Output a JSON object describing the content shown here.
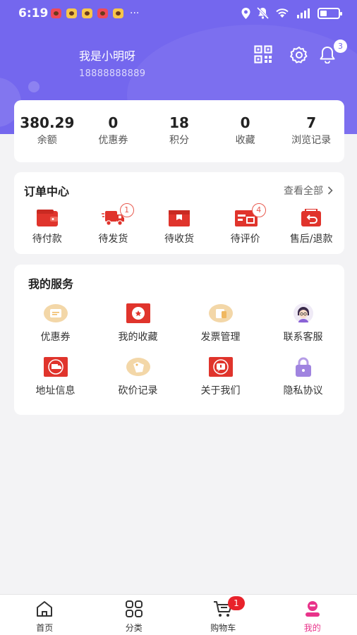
{
  "status_bar": {
    "time": "6:19",
    "more": "···"
  },
  "profile": {
    "name": "我是小明呀",
    "phone": "18888888889",
    "notification_count": "3"
  },
  "stats": [
    {
      "value": "380.29",
      "label": "余额"
    },
    {
      "value": "0",
      "label": "优惠券"
    },
    {
      "value": "18",
      "label": "积分"
    },
    {
      "value": "0",
      "label": "收藏"
    },
    {
      "value": "7",
      "label": "浏览记录"
    }
  ],
  "orders": {
    "title": "订单中心",
    "view_all": "查看全部",
    "items": [
      {
        "label": "待付款",
        "icon": "wallet-icon",
        "badge": ""
      },
      {
        "label": "待发货",
        "icon": "truck-icon",
        "badge": "1"
      },
      {
        "label": "待收货",
        "icon": "box-icon",
        "badge": ""
      },
      {
        "label": "待评价",
        "icon": "review-icon",
        "badge": "4"
      },
      {
        "label": "售后/退款",
        "icon": "return-icon",
        "badge": ""
      }
    ]
  },
  "services": {
    "title": "我的服务",
    "items": [
      {
        "label": "优惠券",
        "icon": "coupon-icon"
      },
      {
        "label": "我的收藏",
        "icon": "favorite-icon"
      },
      {
        "label": "发票管理",
        "icon": "invoice-icon"
      },
      {
        "label": "联系客服",
        "icon": "customer-service-icon"
      },
      {
        "label": "地址信息",
        "icon": "address-icon"
      },
      {
        "label": "砍价记录",
        "icon": "bargain-icon"
      },
      {
        "label": "关于我们",
        "icon": "about-icon"
      },
      {
        "label": "隐私协议",
        "icon": "lock-icon"
      }
    ]
  },
  "tabbar": {
    "items": [
      {
        "label": "首页",
        "icon": "home-icon"
      },
      {
        "label": "分类",
        "icon": "category-icon"
      },
      {
        "label": "购物车",
        "icon": "cart-icon",
        "badge": "1"
      },
      {
        "label": "我的",
        "icon": "profile-icon",
        "active": true
      }
    ]
  },
  "colors": {
    "brand": "#7467ee",
    "accent_red": "#e0342c",
    "active_tab": "#e8338a"
  }
}
